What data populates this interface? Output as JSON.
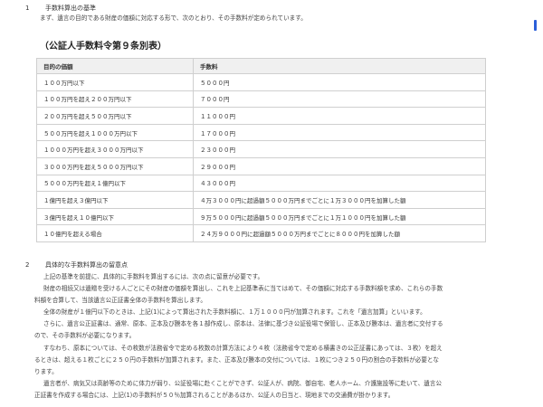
{
  "section1": {
    "number": "1",
    "title": "手数料算出の基準",
    "intro": "まず、遺言の目的である財産の価額に対応する形で、次のとおり、その手数料が定められています。"
  },
  "table_title": "（公証人手数料令第９条別表）",
  "table": {
    "headers": [
      "目的の価額",
      "手数料"
    ],
    "rows": [
      [
        "１００万円以下",
        "５０００円"
      ],
      [
        "１００万円を超え２００万円以下",
        "７０００円"
      ],
      [
        "２００万円を超え５００万円以下",
        "１１０００円"
      ],
      [
        "５００万円を超え１０００万円以下",
        "１７０００円"
      ],
      [
        "１０００万円を超え３０００万円以下",
        "２３０００円"
      ],
      [
        "３０００万円を超え５０００万円以下",
        "２９０００円"
      ],
      [
        "５０００万円を超え１億円以下",
        "４３０００円"
      ],
      [
        "１億円を超え３億円以下",
        "４万３０００円に超過額５０００万円までごとに１万３０００円を加算した額"
      ],
      [
        "３億円を超え１０億円以下",
        "９万５０００円に超過額５０００万円までごとに１万１０００円を加算した額"
      ],
      [
        "１０億円を超える場合",
        "２４万９０００円に超過額５０００万円までごとに８０００円を加算した額"
      ]
    ]
  },
  "section2": {
    "number": "2",
    "title": "具体的な手数料算出の留意点",
    "lines": [
      "上記の基準を前提に、具体的に手数料を算出するには、次の点に留意が必要です。",
      "財産の相続又は遺贈を受ける人ごとにその財産の価額を算出し、これを上記基準表に当てはめて、その価額に対応する手数料額を求め、これらの手数",
      "料額を合算して、当該遺言公正証書全体の手数料を算出します。",
      "全体の財産が１億円以下のときは、上記(1)によって算出された手数料額に、１万１０００円が加算されます。これを「遺言加算」といいます。",
      "さらに、遺言公正証書は、通常、原本、正本及び謄本を各１部作成し、原本は、法律に基づき公証役場で保管し、正本及び謄本は、遺言者に交付する",
      "ので、その手数料が必要になります。",
      "すなわち、原本については、その枚数が法務省令で定める枚数の計算方法により４枚（法務省令で定める横書きの公正証書にあっては、３枚）を超え",
      "るときは、超える１枚ごとに２５０円の手数料が加算されます。また、正本及び謄本の交付については、１枚につき２５０円の割合の手数料が必要とな",
      "ります。",
      "遺言者が、病気又は高齢等のために体力が弱り、公証役場に赴くことができず、公証人が、病院、御自宅、老人ホーム、介護施設等に赴いて、遺言公",
      "正証書を作成する場合には、上記(1)の手数料が５０％加算されることがあるほか、公証人の日当と、現地までの交通費が掛かります。"
    ]
  },
  "colors": {
    "scroll_accent": "#2b5fd9"
  }
}
